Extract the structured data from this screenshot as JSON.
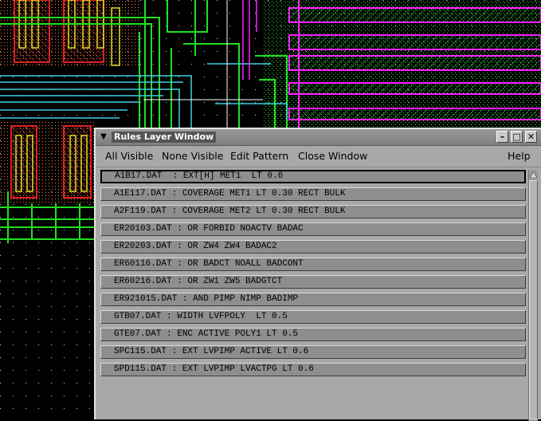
{
  "window": {
    "title": "Rules Layer Window"
  },
  "menu": {
    "all_visible": "All Visible",
    "none_visible": "None Visible",
    "edit_pattern": "Edit Pattern",
    "close_window": "Close Window",
    "help": "Help"
  },
  "rules": [
    "A1B17.DAT  : EXT[H] MET1  LT 0.6",
    "A1E117.DAT : COVERAGE MET1 LT 0.30 RECT BULK",
    "A2F119.DAT : COVERAGE MET2 LT 0.30 RECT BULK",
    "ER20103.DAT : OR FORBID NOACTV BADAC",
    "ER20203.DAT : OR ZW4 ZW4 BADAC2",
    "ER60116.DAT : OR BADCT NOALL BADCONT",
    "ER60216.DAT : OR ZW1 ZW5 BADGTCT",
    "ER921015.DAT : AND PIMP NIMP BADIMP",
    "GTB07.DAT : WIDTH LVFPOLY  LT 0.5",
    "GTE07.DAT : ENC ACTIVE POLY1 LT 0.5",
    "SPC115.DAT : EXT LVPIMP ACTIVE LT 0.6",
    "SPD115.DAT : EXT LVPIMP LVACTPG LT 0.6"
  ],
  "colors": {
    "layout_red": "#e02020",
    "layout_green": "#20e020",
    "layout_cyan": "#40d0e0",
    "layout_yellow": "#e0e020",
    "layout_magenta": "#ff20ff",
    "layout_white": "#ffffff",
    "dialog_bg": "#a8a8a8",
    "row_bg": "#8e8e8e"
  },
  "icons": {
    "window_menu": "triangle-down-icon",
    "minimize": "minimize-icon",
    "maximize": "maximize-icon",
    "close": "close-icon",
    "scroll_up": "arrow-up-icon"
  }
}
